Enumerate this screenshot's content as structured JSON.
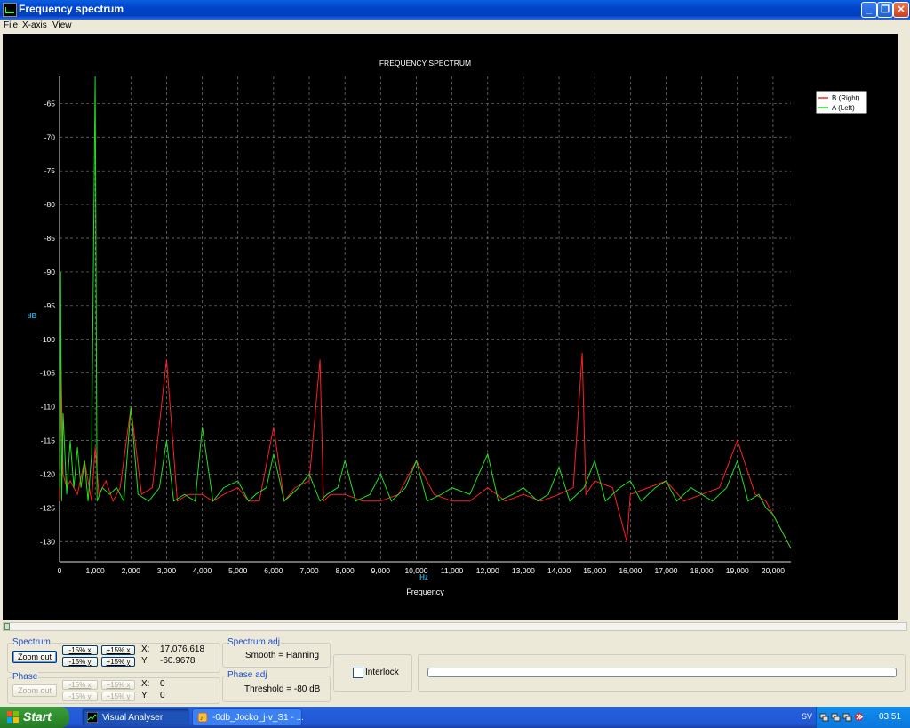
{
  "window": {
    "title": "Frequency spectrum",
    "controls": [
      "_",
      "❐",
      "✕"
    ]
  },
  "menu": [
    "File",
    "X-axis",
    "View"
  ],
  "chart_data": {
    "type": "line",
    "title": "FREQUENCY SPECTRUM",
    "xlabel": "Frequency",
    "x_unit": "Hz",
    "y_unit": "dB",
    "xlim": [
      0,
      20500
    ],
    "ylim": [
      -133,
      -61
    ],
    "x_ticks": [
      "0",
      "1,000",
      "2,000",
      "3,000",
      "4,000",
      "5,000",
      "6,000",
      "7,000",
      "8,000",
      "9,000",
      "10,000",
      "11,000",
      "12,000",
      "13,000",
      "14,000",
      "15,000",
      "16,000",
      "17,000",
      "18,000",
      "19,000",
      "20,000"
    ],
    "y_ticks": [
      "-65",
      "-70",
      "-75",
      "-80",
      "-85",
      "-90",
      "-95",
      "-100",
      "-105",
      "-110",
      "-115",
      "-120",
      "-125",
      "-130"
    ],
    "grid": true,
    "legend_position": "top-right",
    "series": [
      {
        "name": "B (Right)",
        "color": "#ff2020",
        "x": [
          0,
          40,
          100,
          200,
          300,
          500,
          700,
          900,
          1000,
          1100,
          1300,
          1500,
          1700,
          2000,
          2300,
          2600,
          3000,
          3300,
          3600,
          4000,
          4300,
          4600,
          5000,
          5300,
          5600,
          6000,
          6300,
          6600,
          7000,
          7300,
          7400,
          7600,
          8000,
          8500,
          9000,
          9500,
          10000,
          10500,
          11000,
          11500,
          12000,
          12500,
          13000,
          13500,
          14000,
          14400,
          14650,
          14750,
          15000,
          15500,
          15900,
          16000,
          16500,
          17000,
          17500,
          18000,
          18500,
          19000,
          19500,
          19800,
          20000,
          20200,
          20400,
          20500
        ],
        "y": [
          -124,
          -103,
          -120,
          -122,
          -121,
          -123,
          -118,
          -124,
          -116,
          -123,
          -121,
          -124,
          -122,
          -110,
          -123,
          -122,
          -103,
          -124,
          -123,
          -123,
          -124,
          -123,
          -122,
          -124,
          -124,
          -113,
          -124,
          -122,
          -121,
          -103,
          -124,
          -123,
          -123,
          -124,
          -124,
          -123,
          -118,
          -123,
          -124,
          -124,
          -122,
          -124,
          -123,
          -124,
          -123,
          -122,
          -102,
          -123,
          -121,
          -122,
          -130,
          -123,
          -122,
          -121,
          -124,
          -123,
          -122,
          -115,
          -123,
          -124,
          -126,
          -128,
          -130,
          -131
        ]
      },
      {
        "name": "A (Left)",
        "color": "#20e020",
        "x": [
          0,
          30,
          60,
          100,
          200,
          300,
          400,
          500,
          600,
          700,
          800,
          900,
          1000,
          1050,
          1200,
          1400,
          1600,
          1800,
          2000,
          2200,
          2500,
          2800,
          3000,
          3200,
          3500,
          3800,
          4000,
          4300,
          4600,
          5000,
          5300,
          5500,
          5800,
          6000,
          6300,
          6700,
          7000,
          7300,
          7500,
          7800,
          8000,
          8300,
          8700,
          9000,
          9300,
          9700,
          10000,
          10300,
          10700,
          11000,
          11500,
          12000,
          12300,
          12700,
          13000,
          13400,
          13700,
          14000,
          14300,
          14700,
          15000,
          15300,
          15700,
          16000,
          16300,
          16700,
          17000,
          17300,
          17700,
          18000,
          18300,
          18700,
          19000,
          19300,
          19600,
          19800,
          20000,
          20200,
          20400,
          20500
        ],
        "y": [
          -122,
          -90,
          -124,
          -111,
          -123,
          -115,
          -122,
          -116,
          -122,
          -118,
          -124,
          -117,
          -61,
          -124,
          -122,
          -123,
          -122,
          -124,
          -110,
          -123,
          -124,
          -122,
          -115,
          -124,
          -123,
          -124,
          -113,
          -124,
          -122,
          -121,
          -124,
          -123,
          -122,
          -117,
          -124,
          -122,
          -120,
          -124,
          -123,
          -122,
          -118,
          -124,
          -123,
          -120,
          -124,
          -122,
          -118,
          -124,
          -123,
          -122,
          -123,
          -117,
          -124,
          -123,
          -122,
          -124,
          -123,
          -119,
          -124,
          -122,
          -118,
          -124,
          -122,
          -121,
          -124,
          -122,
          -121,
          -124,
          -122,
          -123,
          -124,
          -122,
          -118,
          -124,
          -123,
          -125,
          -126,
          -128,
          -130,
          -131
        ]
      }
    ]
  },
  "controls": {
    "spectrum": {
      "title": "Spectrum",
      "zoom_out": "Zoom out",
      "minus_x": "-15% x",
      "plus_x": "+15% x",
      "minus_y": "-15% y",
      "plus_y": "+15% y",
      "x_label": "X:",
      "x_value": "17,076.618",
      "y_label": "Y:",
      "y_value": "-60.9678"
    },
    "phase": {
      "title": "Phase",
      "zoom_out": "Zoom out",
      "minus_x": "-15% x",
      "plus_x": "+15% x",
      "minus_y": "-15% y",
      "plus_y": "+15% y",
      "x_label": "X:",
      "x_value": "0",
      "y_label": "Y:",
      "y_value": "0"
    },
    "spectrum_adj": {
      "title": "Spectrum adj",
      "value": "Smooth = Hanning"
    },
    "phase_adj": {
      "title": "Phase adj",
      "value": "Threshold = -80 dB"
    },
    "interlock": {
      "label": "Interlock",
      "checked": false
    }
  },
  "taskbar": {
    "start": "Start",
    "tasks": [
      "Visual Analyser",
      "-0db_Jocko_j-v_S1 - ..."
    ],
    "language": "SV",
    "clock": "03:51"
  }
}
